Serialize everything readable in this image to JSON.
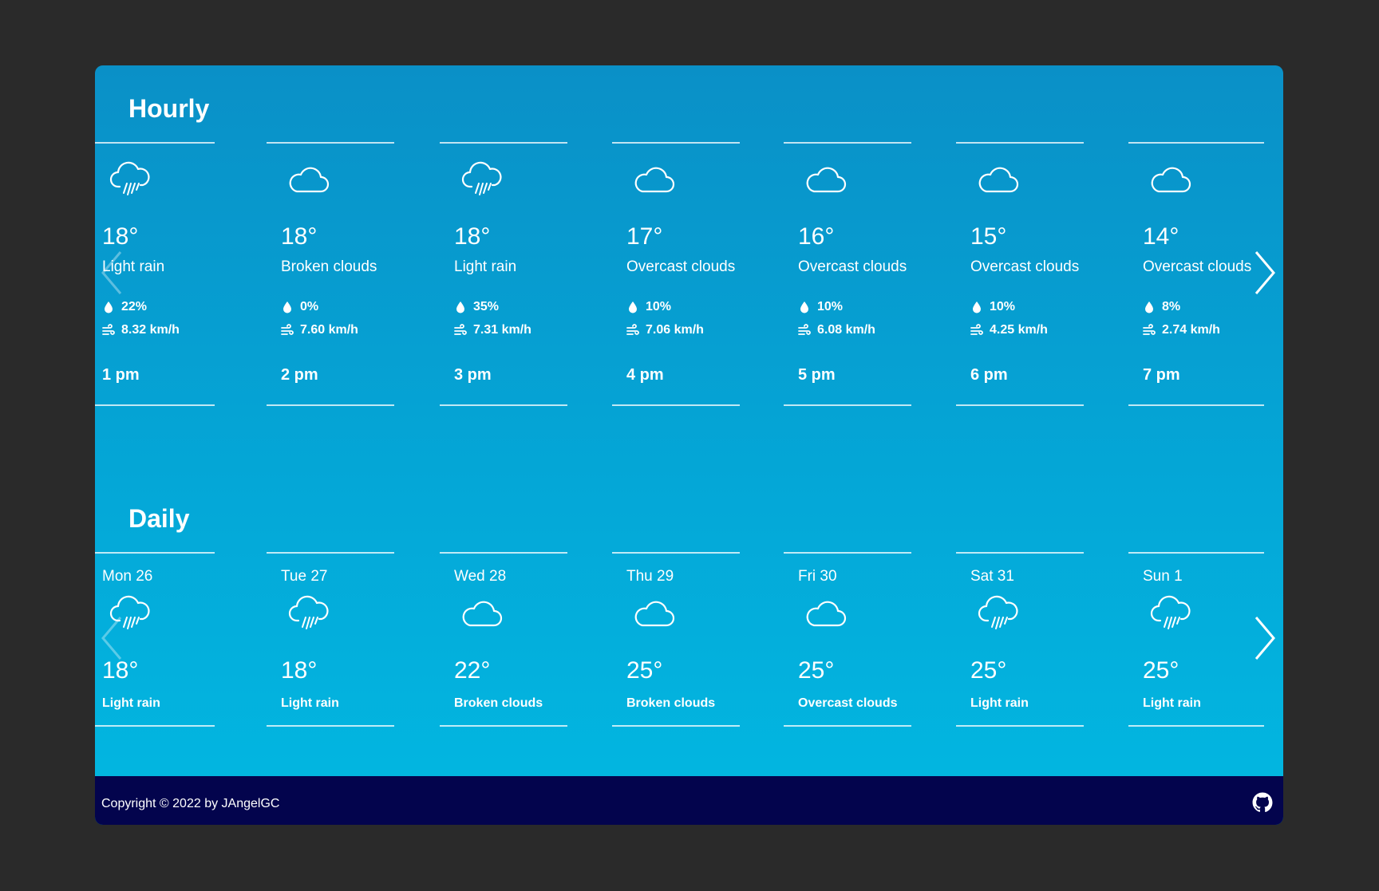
{
  "hourly": {
    "title": "Hourly",
    "items": [
      {
        "icon": "rain-cloud-icon",
        "temp": "18°",
        "desc": "Light rain",
        "precip": "22%",
        "wind": "8.32 km/h",
        "time": "1 pm"
      },
      {
        "icon": "cloud-icon",
        "temp": "18°",
        "desc": "Broken clouds",
        "precip": "0%",
        "wind": "7.60 km/h",
        "time": "2 pm"
      },
      {
        "icon": "rain-cloud-icon",
        "temp": "18°",
        "desc": "Light rain",
        "precip": "35%",
        "wind": "7.31 km/h",
        "time": "3 pm"
      },
      {
        "icon": "cloud-icon",
        "temp": "17°",
        "desc": "Overcast clouds",
        "precip": "10%",
        "wind": "7.06 km/h",
        "time": "4 pm"
      },
      {
        "icon": "cloud-icon",
        "temp": "16°",
        "desc": "Overcast clouds",
        "precip": "10%",
        "wind": "6.08 km/h",
        "time": "5 pm"
      },
      {
        "icon": "cloud-icon",
        "temp": "15°",
        "desc": "Overcast clouds",
        "precip": "10%",
        "wind": "4.25 km/h",
        "time": "6 pm"
      },
      {
        "icon": "cloud-icon",
        "temp": "14°",
        "desc": "Overcast clouds",
        "precip": "8%",
        "wind": "2.74 km/h",
        "time": "7 pm"
      }
    ]
  },
  "daily": {
    "title": "Daily",
    "items": [
      {
        "day": "Mon 26",
        "icon": "rain-cloud-icon",
        "temp": "18°",
        "desc": "Light rain"
      },
      {
        "day": "Tue 27",
        "icon": "rain-cloud-icon",
        "temp": "18°",
        "desc": "Light rain"
      },
      {
        "day": "Wed 28",
        "icon": "cloud-icon",
        "temp": "22°",
        "desc": "Broken clouds"
      },
      {
        "day": "Thu 29",
        "icon": "cloud-icon",
        "temp": "25°",
        "desc": "Broken clouds"
      },
      {
        "day": "Fri 30",
        "icon": "cloud-icon",
        "temp": "25°",
        "desc": "Overcast clouds"
      },
      {
        "day": "Sat 31",
        "icon": "rain-cloud-icon",
        "temp": "25°",
        "desc": "Light rain"
      },
      {
        "day": "Sun 1",
        "icon": "rain-cloud-icon",
        "temp": "25°",
        "desc": "Light rain"
      }
    ]
  },
  "footer": {
    "copyright": "Copyright © 2022 by JAngelGC",
    "icon": "github-icon"
  },
  "colors": {
    "page_bg": "#2a2a2a",
    "gradient_top": "#0a90c7",
    "gradient_bottom": "#02b8e2",
    "footer_bg": "#03044d"
  }
}
